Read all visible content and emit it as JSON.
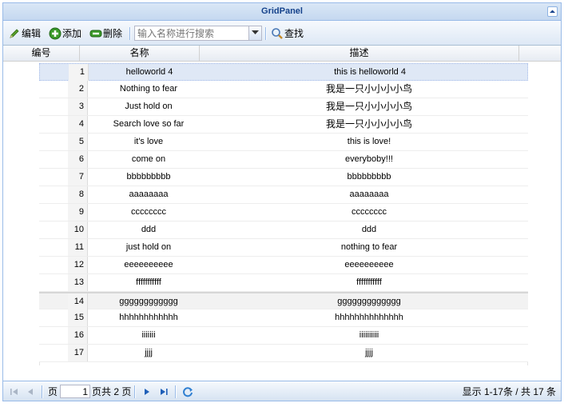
{
  "panel": {
    "title": "GridPanel"
  },
  "toolbar": {
    "edit_label": "编辑",
    "add_label": "添加",
    "delete_label": "删除",
    "search_placeholder": "输入名称进行搜索",
    "find_label": "查找"
  },
  "columns": {
    "num": "编号",
    "name": "名称",
    "desc": "描述"
  },
  "rows": [
    {
      "num": "1",
      "name": "helloworld 4",
      "desc": "this is helloworld 4"
    },
    {
      "num": "2",
      "name": "Nothing to fear",
      "desc": "我是一只小小小小鸟"
    },
    {
      "num": "3",
      "name": "Just hold on",
      "desc": "我是一只小小小小鸟"
    },
    {
      "num": "4",
      "name": "Search love so far",
      "desc": "我是一只小小小小鸟"
    },
    {
      "num": "5",
      "name": "it's love",
      "desc": "this is love!"
    },
    {
      "num": "6",
      "name": "come on",
      "desc": "everyboby!!!"
    },
    {
      "num": "7",
      "name": "bbbbbbbbb",
      "desc": "bbbbbbbbb"
    },
    {
      "num": "8",
      "name": "aaaaaaaa",
      "desc": "aaaaaaaa"
    },
    {
      "num": "9",
      "name": "cccccccc",
      "desc": "cccccccc"
    },
    {
      "num": "10",
      "name": "ddd",
      "desc": "ddd"
    },
    {
      "num": "11",
      "name": "just hold on",
      "desc": "nothing to fear"
    },
    {
      "num": "12",
      "name": "eeeeeeeeee",
      "desc": "eeeeeeeeee"
    },
    {
      "num": "13",
      "name": "fffffffffff",
      "desc": "fffffffffff"
    },
    {
      "num": "14",
      "name": "gggggggggggg",
      "desc": "ggggggggggggg"
    },
    {
      "num": "15",
      "name": "hhhhhhhhhhhh",
      "desc": "hhhhhhhhhhhhhh"
    },
    {
      "num": "16",
      "name": "iiiiiii",
      "desc": "iiiiiiiiii"
    },
    {
      "num": "17",
      "name": "jjjj",
      "desc": "jjjj"
    }
  ],
  "pager": {
    "page_label": "页",
    "page_value": "1",
    "total_pages_label": "页共 2 页",
    "status": "显示 1-17条 / 共 17 条"
  },
  "colors": {
    "header_text": "#15428b",
    "selected_row": "#dfe8f6",
    "border": "#99bbe8"
  }
}
